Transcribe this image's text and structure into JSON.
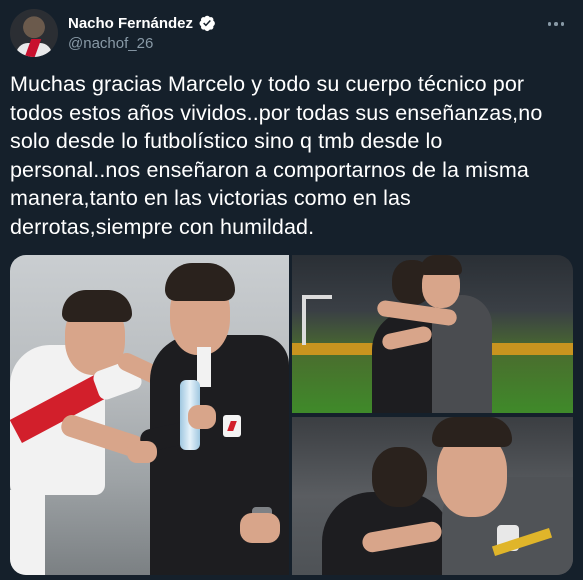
{
  "author": {
    "display_name": "Nacho Fernández",
    "handle": "@nachof_26",
    "verified": true
  },
  "tweet": {
    "text": "Muchas gracias Marcelo y todo su cuerpo técnico por\ntodos estos años vividos..por todas sus enseñanzas,no\nsolo desde lo futbolístico sino q tmb desde lo\npersonal..nos enseñaron a comportarnos de la misma\nmanera,tanto en las victorias como en las\nderrotas,siempre con humildad.",
    "photo_count": 3
  },
  "icons": {
    "verified": "verified-badge-icon",
    "more": "more-options-icon"
  },
  "colors": {
    "background": "#15202b",
    "text_primary": "#ffffff",
    "text_secondary": "#8899a6",
    "verified_badge": "#ffffff"
  }
}
